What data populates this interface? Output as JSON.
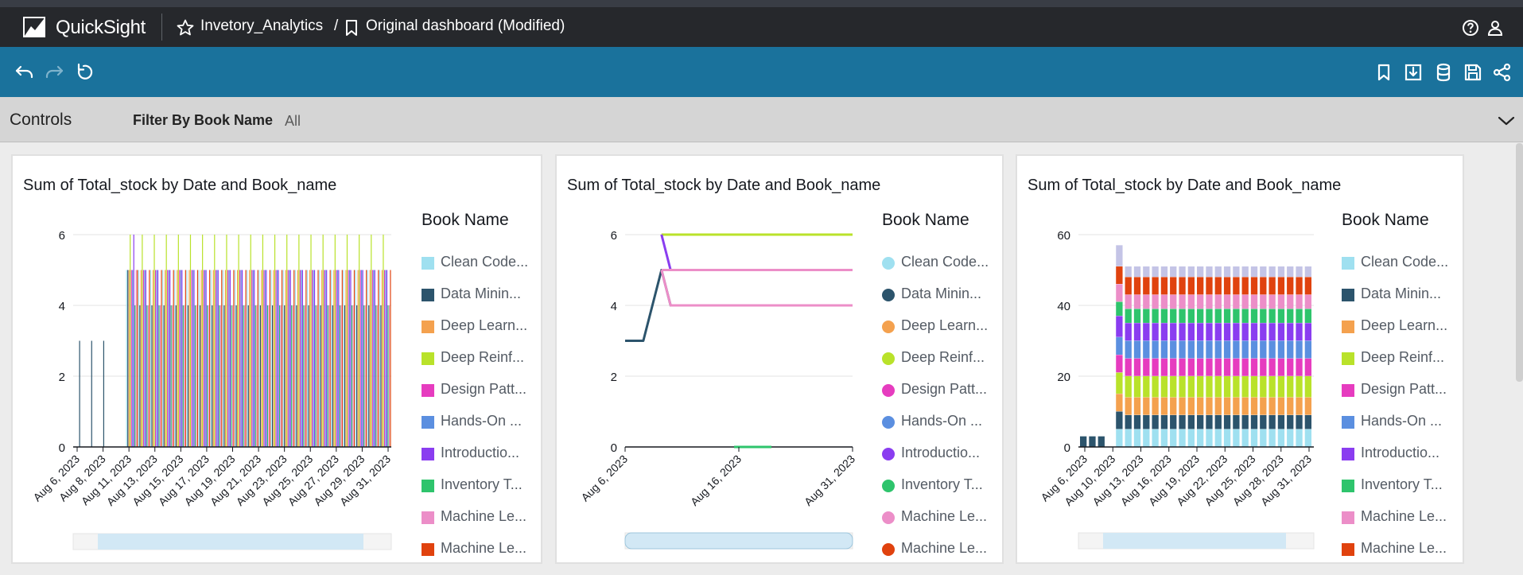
{
  "app": {
    "brand": "QuickSight",
    "breadcrumb_analysis": "Invetory_Analytics",
    "breadcrumb_sep": "/",
    "breadcrumb_dashboard": "Original dashboard (Modified)"
  },
  "controls": {
    "title": "Controls",
    "filter_label": "Filter By Book Name",
    "filter_value": "All"
  },
  "colors": {
    "nav_bg": "#26282c",
    "toolbar_bg": "#1a729c",
    "controls_bg": "#d5d5d5"
  },
  "legend": {
    "title": "Book Name",
    "items": [
      {
        "label": "Clean Code...",
        "color": "#9fe0f0"
      },
      {
        "label": "Data Minin...",
        "color": "#2c546c"
      },
      {
        "label": "Deep Learn...",
        "color": "#f4a14e"
      },
      {
        "label": "Deep Reinf...",
        "color": "#b9e22a"
      },
      {
        "label": "Design Patt...",
        "color": "#e63cbf"
      },
      {
        "label": "Hands-On ...",
        "color": "#5b8fe0"
      },
      {
        "label": "Introductio...",
        "color": "#8a3df0"
      },
      {
        "label": "Inventory T...",
        "color": "#2ec46c"
      },
      {
        "label": "Machine Le...",
        "color": "#ec8ec8"
      },
      {
        "label": "Machine Le...",
        "color": "#e0420e"
      }
    ]
  },
  "charts": [
    {
      "title": "Sum of Total_stock by Date and Book_name"
    },
    {
      "title": "Sum of Total_stock by Date and Book_name"
    },
    {
      "title": "Sum of Total_stock by Date and Book_name"
    }
  ],
  "chart_data": [
    {
      "type": "bar",
      "title": "Sum of Total_stock by Date and Book_name",
      "xlabel": "",
      "ylabel": "",
      "ylim": [
        0,
        6
      ],
      "yticks": [
        0,
        2,
        4,
        6
      ],
      "xticks": [
        "Aug 6, 2023",
        "Aug 8, 2023",
        "Aug 11, 2023",
        "Aug 13, 2023",
        "Aug 15, 2023",
        "Aug 17, 2023",
        "Aug 19, 2023",
        "Aug 21, 2023",
        "Aug 23, 2023",
        "Aug 25, 2023",
        "Aug 27, 2023",
        "Aug 29, 2023",
        "Aug 31, 2023"
      ],
      "x": [
        "Aug 6, 2023",
        "Aug 7, 2023",
        "Aug 8, 2023",
        "Aug 9, 2023",
        "Aug 10, 2023",
        "Aug 11, 2023",
        "Aug 12, 2023",
        "Aug 13, 2023",
        "Aug 14, 2023",
        "Aug 15, 2023",
        "Aug 16, 2023",
        "Aug 17, 2023",
        "Aug 18, 2023",
        "Aug 19, 2023",
        "Aug 20, 2023",
        "Aug 21, 2023",
        "Aug 22, 2023",
        "Aug 23, 2023",
        "Aug 24, 2023",
        "Aug 25, 2023",
        "Aug 26, 2023",
        "Aug 27, 2023",
        "Aug 28, 2023",
        "Aug 29, 2023",
        "Aug 30, 2023",
        "Aug 31, 2023"
      ],
      "series": [
        {
          "name": "Clean Code...",
          "values": [
            null,
            null,
            null,
            null,
            5,
            5,
            5,
            5,
            5,
            5,
            5,
            5,
            5,
            5,
            5,
            5,
            5,
            5,
            5,
            5,
            5,
            5,
            5,
            5,
            5,
            5
          ]
        },
        {
          "name": "Data Minin...",
          "values": [
            3,
            3,
            3,
            null,
            5,
            4,
            4,
            4,
            4,
            4,
            4,
            4,
            4,
            4,
            4,
            4,
            4,
            4,
            4,
            4,
            4,
            4,
            4,
            4,
            4,
            4
          ]
        },
        {
          "name": "Deep Learn...",
          "values": [
            null,
            null,
            null,
            null,
            5,
            5,
            5,
            5,
            5,
            5,
            5,
            5,
            5,
            5,
            5,
            5,
            5,
            5,
            5,
            5,
            5,
            5,
            5,
            5,
            5,
            5
          ]
        },
        {
          "name": "Deep Reinf...",
          "values": [
            null,
            null,
            null,
            null,
            6,
            6,
            6,
            6,
            6,
            6,
            6,
            6,
            6,
            6,
            6,
            6,
            6,
            6,
            6,
            6,
            6,
            6,
            6,
            6,
            6,
            6
          ]
        },
        {
          "name": "Design Patt...",
          "values": [
            null,
            null,
            null,
            null,
            5,
            5,
            5,
            5,
            5,
            5,
            5,
            5,
            5,
            5,
            5,
            5,
            5,
            5,
            5,
            5,
            5,
            5,
            5,
            5,
            5,
            5
          ]
        },
        {
          "name": "Hands-On ...",
          "values": [
            null,
            null,
            null,
            null,
            5,
            5,
            5,
            5,
            5,
            5,
            5,
            5,
            5,
            5,
            5,
            5,
            5,
            5,
            5,
            5,
            5,
            5,
            5,
            5,
            5,
            5
          ]
        },
        {
          "name": "Introductio...",
          "values": [
            null,
            null,
            null,
            null,
            6,
            5,
            5,
            5,
            5,
            5,
            5,
            5,
            5,
            5,
            5,
            5,
            5,
            5,
            5,
            5,
            5,
            5,
            5,
            5,
            5,
            5
          ]
        },
        {
          "name": "Inventory T...",
          "values": [
            null,
            null,
            null,
            null,
            4,
            4,
            4,
            4,
            4,
            4,
            4,
            4,
            4,
            4,
            4,
            4,
            4,
            4,
            4,
            4,
            4,
            4,
            4,
            4,
            4,
            4
          ]
        },
        {
          "name": "Machine Le...",
          "values": [
            null,
            null,
            null,
            null,
            5,
            4,
            4,
            4,
            4,
            4,
            4,
            4,
            4,
            4,
            4,
            4,
            4,
            4,
            4,
            4,
            4,
            4,
            4,
            4,
            4,
            4
          ]
        },
        {
          "name": "Machine Le...",
          "values": [
            null,
            null,
            null,
            null,
            5,
            5,
            5,
            5,
            5,
            5,
            5,
            5,
            5,
            5,
            5,
            5,
            5,
            5,
            5,
            5,
            5,
            5,
            5,
            5,
            5,
            5
          ]
        }
      ]
    },
    {
      "type": "line",
      "title": "Sum of Total_stock by Date and Book_name",
      "xlabel": "",
      "ylabel": "",
      "ylim": [
        0,
        6
      ],
      "yticks": [
        0,
        2,
        4,
        6
      ],
      "xticks": [
        "Aug 6, 2023",
        "Aug 16, 2023",
        "Aug 31, 2023"
      ],
      "x": [
        "Aug 6, 2023",
        "Aug 7, 2023",
        "Aug 8, 2023",
        "Aug 9, 2023",
        "Aug 10, 2023",
        "Aug 11, 2023",
        "Aug 31, 2023"
      ],
      "series": [
        {
          "name": "Data Minin...",
          "values": [
            3,
            3,
            3,
            4,
            5,
            4,
            4
          ]
        },
        {
          "name": "Deep Reinf...",
          "values": [
            null,
            null,
            null,
            null,
            6,
            6,
            6
          ]
        },
        {
          "name": "Introductio...",
          "values": [
            null,
            null,
            null,
            null,
            6,
            5,
            5
          ]
        },
        {
          "name": "Machine Le...",
          "values": [
            null,
            null,
            null,
            null,
            5,
            5,
            5
          ]
        },
        {
          "name": "Machine Le...",
          "values": [
            null,
            null,
            null,
            null,
            5,
            4,
            4
          ]
        }
      ]
    },
    {
      "type": "bar",
      "stacked": true,
      "title": "Sum of Total_stock by Date and Book_name",
      "xlabel": "",
      "ylabel": "",
      "ylim": [
        0,
        60
      ],
      "yticks": [
        0,
        20,
        40,
        60
      ],
      "xticks": [
        "Aug 6, 2023",
        "Aug 10, 2023",
        "Aug 13, 2023",
        "Aug 16, 2023",
        "Aug 19, 2023",
        "Aug 22, 2023",
        "Aug 25, 2023",
        "Aug 28, 2023",
        "Aug 31, 2023"
      ],
      "totals": [
        3,
        3,
        3,
        null,
        57,
        51,
        51,
        51,
        51,
        51,
        51,
        51,
        51,
        51,
        51,
        51,
        51,
        51,
        51,
        51,
        51,
        51,
        51,
        51,
        51,
        51
      ]
    }
  ]
}
